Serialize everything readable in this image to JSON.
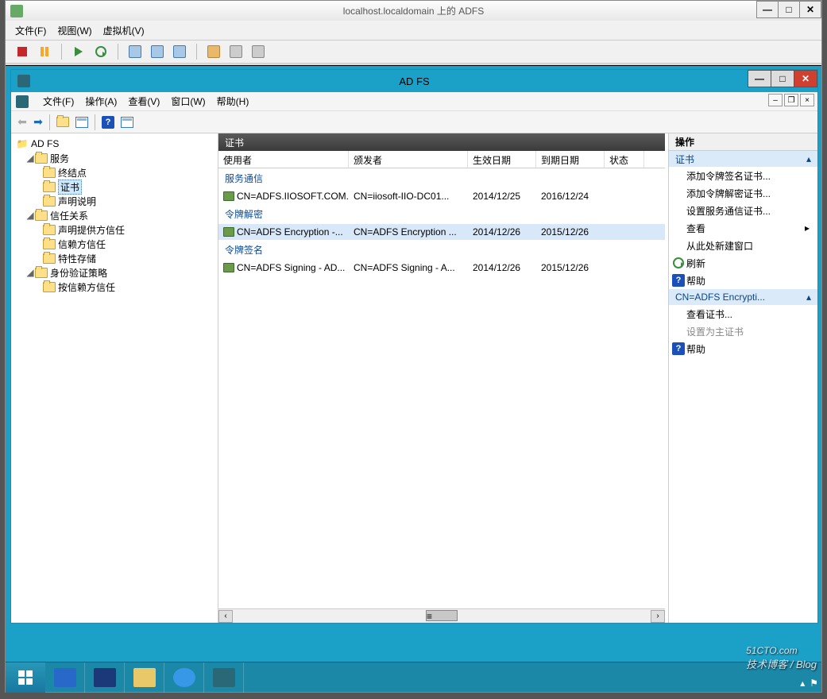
{
  "vm": {
    "title": "localhost.localdomain 上的 ADFS",
    "menu": {
      "file": "文件(F)",
      "view": "视图(W)",
      "vmachine": "虚拟机(V)"
    }
  },
  "adfs": {
    "title": "AD FS",
    "menu": {
      "file": "文件(F)",
      "action": "操作(A)",
      "view": "查看(V)",
      "window": "窗口(W)",
      "help": "帮助(H)"
    },
    "tree": {
      "root": "AD FS",
      "svc": "服务",
      "endpoints": "终结点",
      "certs": "证书",
      "claims": "声明说明",
      "trust": "信任关系",
      "cp": "声明提供方信任",
      "rp": "信赖方信任",
      "attr": "特性存储",
      "auth": "身份验证策略",
      "perrp": "按信赖方信任"
    },
    "list": {
      "header": "证书",
      "cols": {
        "subj": "使用者",
        "issuer": "颁发者",
        "eff": "生效日期",
        "exp": "到期日期",
        "stat": "状态"
      },
      "grp1": "服务通信",
      "grp2": "令牌解密",
      "grp3": "令牌签名",
      "r1": {
        "subj": "CN=ADFS.IIOSOFT.COM...",
        "issuer": "CN=iiosoft-IIO-DC01...",
        "eff": "2014/12/25",
        "exp": "2016/12/24"
      },
      "r2": {
        "subj": "CN=ADFS Encryption -...",
        "issuer": "CN=ADFS Encryption ...",
        "eff": "2014/12/26",
        "exp": "2015/12/26"
      },
      "r3": {
        "subj": "CN=ADFS Signing - AD...",
        "issuer": "CN=ADFS Signing - A...",
        "eff": "2014/12/26",
        "exp": "2015/12/26"
      }
    },
    "actions": {
      "header": "操作",
      "sec1": "证书",
      "a1": "添加令牌签名证书...",
      "a2": "添加令牌解密证书...",
      "a3": "设置服务通信证书...",
      "a4": "查看",
      "a5": "从此处新建窗口",
      "a6": "刷新",
      "a7": "帮助",
      "sec2": "CN=ADFS Encrypti...",
      "b1": "查看证书...",
      "b2": "设置为主证书",
      "b3": "帮助"
    }
  },
  "taskbar": {
    "time": "",
    "show_time": false
  },
  "watermark": {
    "main": "51CTO.com",
    "sub": "技术博客 / Blog"
  }
}
